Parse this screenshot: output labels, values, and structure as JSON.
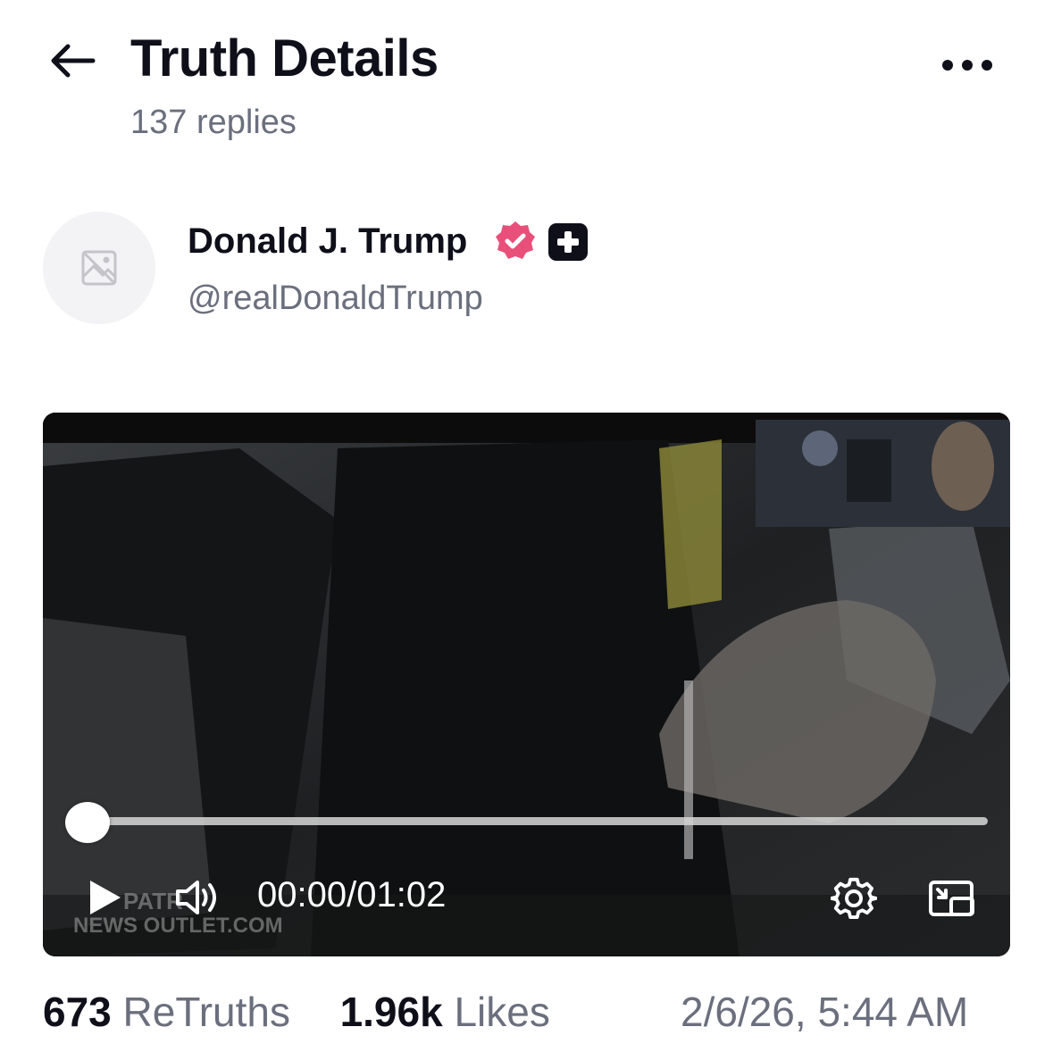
{
  "header": {
    "title": "Truth Details",
    "replies": "137 replies"
  },
  "author": {
    "name": "Donald J. Trump",
    "handle": "@realDonaldTrump",
    "verified_color": "#e8507a"
  },
  "video": {
    "current_time": "00:00",
    "separator": "/",
    "duration": "01:02",
    "progress": 0
  },
  "stats": {
    "retruths_count": "673",
    "retruths_label": "ReTruths",
    "likes_count": "1.96k",
    "likes_label": "Likes",
    "timestamp": "2/6/26, 5:44 AM"
  },
  "icons": [
    "arrow-left-icon",
    "more-horizontal-icon",
    "image-placeholder-icon",
    "verified-badge-icon",
    "plus-badge-icon",
    "play-icon",
    "volume-icon",
    "settings-icon",
    "picture-in-picture-icon"
  ]
}
